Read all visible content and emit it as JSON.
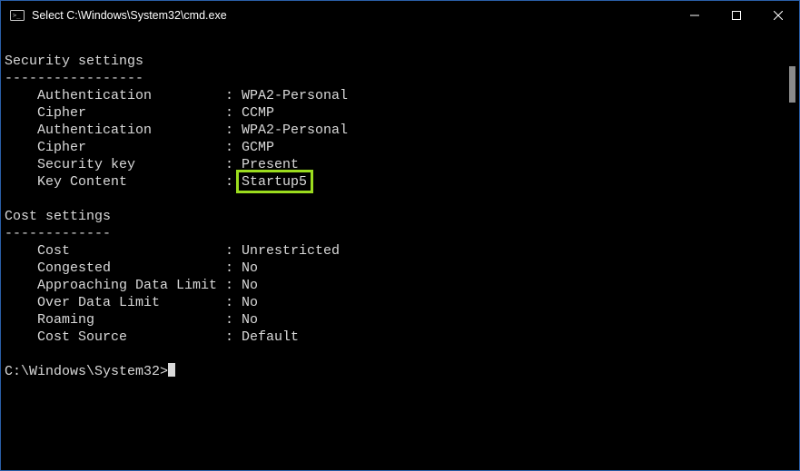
{
  "titlebar": {
    "title": "Select C:\\Windows\\System32\\cmd.exe"
  },
  "terminal": {
    "security": {
      "heading": "Security settings",
      "rule": "-----------------",
      "rows": [
        {
          "label": "Authentication",
          "value": "WPA2-Personal"
        },
        {
          "label": "Cipher",
          "value": "CCMP"
        },
        {
          "label": "Authentication",
          "value": "WPA2-Personal"
        },
        {
          "label": "Cipher",
          "value": "GCMP"
        },
        {
          "label": "Security key",
          "value": "Present"
        },
        {
          "label": "Key Content",
          "value": "Startup5",
          "highlight": true
        }
      ]
    },
    "cost": {
      "heading": "Cost settings",
      "rule": "-------------",
      "rows": [
        {
          "label": "Cost",
          "value": "Unrestricted"
        },
        {
          "label": "Congested",
          "value": "No"
        },
        {
          "label": "Approaching Data Limit",
          "value": "No"
        },
        {
          "label": "Over Data Limit",
          "value": "No"
        },
        {
          "label": "Roaming",
          "value": "No"
        },
        {
          "label": "Cost Source",
          "value": "Default"
        }
      ]
    },
    "prompt": "C:\\Windows\\System32>"
  },
  "meta": {
    "label_width": 22
  }
}
